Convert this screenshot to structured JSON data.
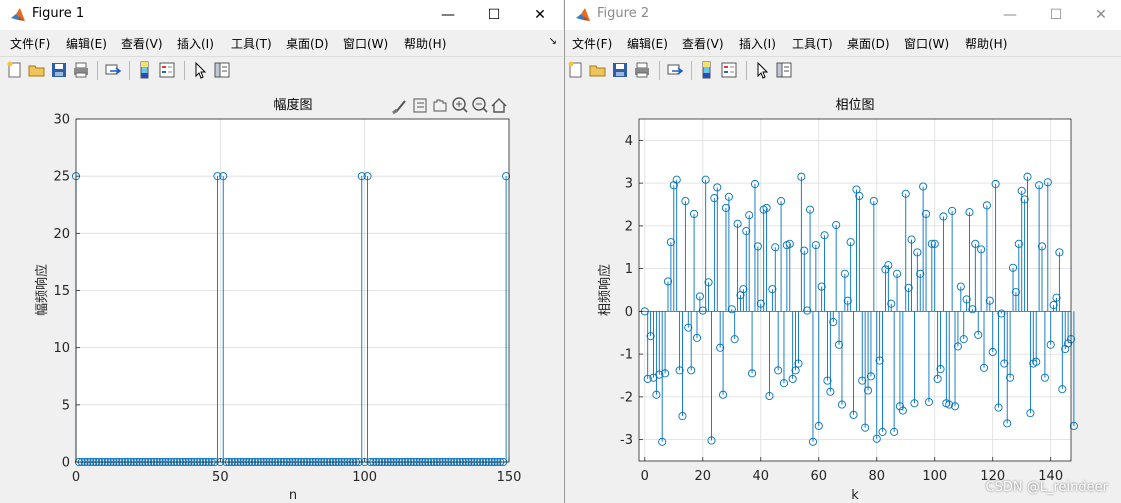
{
  "window1": {
    "title": "Figure 1",
    "min_glyph": "—",
    "max_glyph": "☐",
    "close_glyph": "✕",
    "menu": [
      "文件(F)",
      "编辑(E)",
      "查看(V)",
      "插入(I)",
      "工具(T)",
      "桌面(D)",
      "窗口(W)",
      "帮助(H)"
    ],
    "menu_more_glyph": "↘"
  },
  "window2": {
    "title": "Figure 2",
    "min_glyph": "—",
    "max_glyph": "☐",
    "close_glyph": "✕",
    "menu": [
      "文件(F)",
      "编辑(E)",
      "查看(V)",
      "插入(I)",
      "工具(T)",
      "桌面(D)",
      "窗口(W)",
      "帮助(H)"
    ]
  },
  "toolbar_icons": [
    "new-figure-icon",
    "open-file-icon",
    "save-icon",
    "print-icon",
    "link-plot-icon",
    "insert-colorbar-icon",
    "insert-legend-icon",
    "edit-plot-icon",
    "property-inspector-icon"
  ],
  "axes_toolbar_icons": [
    "brush-icon",
    "data-tips-icon",
    "pan-icon",
    "zoom-in-icon",
    "zoom-out-icon",
    "home-icon"
  ],
  "colors": {
    "stem": "#0072bd",
    "grid": "#dcdcdc",
    "axes_bg": "#ffffff"
  },
  "watermark": "CSDN @L_reindeer",
  "chart_data": [
    {
      "type": "stem",
      "title": "幅度图",
      "xlabel": "n",
      "ylabel": "幅频响应",
      "xlim": [
        0,
        150
      ],
      "ylim": [
        0,
        30
      ],
      "xticks": [
        "0",
        "50",
        "100",
        "150"
      ],
      "yticks": [
        "0",
        "5",
        "10",
        "15",
        "20",
        "25",
        "30"
      ],
      "grid": true,
      "x": [
        0,
        1,
        2,
        3,
        4,
        5,
        6,
        7,
        8,
        9,
        10,
        11,
        12,
        13,
        14,
        15,
        16,
        17,
        18,
        19,
        20,
        21,
        22,
        23,
        24,
        25,
        26,
        27,
        28,
        29,
        30,
        31,
        32,
        33,
        34,
        35,
        36,
        37,
        38,
        39,
        40,
        41,
        42,
        43,
        44,
        45,
        46,
        47,
        48,
        49,
        50,
        51,
        52,
        53,
        54,
        55,
        56,
        57,
        58,
        59,
        60,
        61,
        62,
        63,
        64,
        65,
        66,
        67,
        68,
        69,
        70,
        71,
        72,
        73,
        74,
        75,
        76,
        77,
        78,
        79,
        80,
        81,
        82,
        83,
        84,
        85,
        86,
        87,
        88,
        89,
        90,
        91,
        92,
        93,
        94,
        95,
        96,
        97,
        98,
        99,
        100,
        101,
        102,
        103,
        104,
        105,
        106,
        107,
        108,
        109,
        110,
        111,
        112,
        113,
        114,
        115,
        116,
        117,
        118,
        119,
        120,
        121,
        122,
        123,
        124,
        125,
        126,
        127,
        128,
        129,
        130,
        131,
        132,
        133,
        134,
        135,
        136,
        137,
        138,
        139,
        140,
        141,
        142,
        143,
        144,
        145,
        146,
        147,
        148,
        149
      ],
      "values": [
        25,
        0,
        0,
        0,
        0,
        0,
        0,
        0,
        0,
        0,
        0,
        0,
        0,
        0,
        0,
        0,
        0,
        0,
        0,
        0,
        0,
        0,
        0,
        0,
        0,
        0,
        0,
        0,
        0,
        0,
        0,
        0,
        0,
        0,
        0,
        0,
        0,
        0,
        0,
        0,
        0,
        0,
        0,
        0,
        0,
        0,
        0,
        0,
        0,
        25,
        0,
        25,
        0,
        0,
        0,
        0,
        0,
        0,
        0,
        0,
        0,
        0,
        0,
        0,
        0,
        0,
        0,
        0,
        0,
        0,
        0,
        0,
        0,
        0,
        0,
        0,
        0,
        0,
        0,
        0,
        0,
        0,
        0,
        0,
        0,
        0,
        0,
        0,
        0,
        0,
        0,
        0,
        0,
        0,
        0,
        0,
        0,
        0,
        0,
        25,
        0,
        25,
        0,
        0,
        0,
        0,
        0,
        0,
        0,
        0,
        0,
        0,
        0,
        0,
        0,
        0,
        0,
        0,
        0,
        0,
        0,
        0,
        0,
        0,
        0,
        0,
        0,
        0,
        0,
        0,
        0,
        0,
        0,
        0,
        0,
        0,
        0,
        0,
        0,
        0,
        0,
        0,
        0,
        0,
        0,
        0,
        0,
        0,
        0,
        25
      ]
    },
    {
      "type": "stem",
      "title": "相位图",
      "xlabel": "k",
      "ylabel": "相频响应",
      "xlim": [
        -2,
        147
      ],
      "ylim": [
        -3.5,
        4.5
      ],
      "xticks": [
        "0",
        "20",
        "40",
        "60",
        "80",
        "100",
        "120",
        "140"
      ],
      "xtick_values": [
        0,
        20,
        40,
        60,
        80,
        100,
        120,
        140
      ],
      "yticks": [
        "-3",
        "-2",
        "-1",
        "0",
        "1",
        "2",
        "3",
        "4"
      ],
      "ytick_values": [
        -3,
        -2,
        -1,
        0,
        1,
        2,
        3,
        4
      ],
      "grid": true,
      "values": [
        0.0,
        -1.58,
        -0.58,
        -1.55,
        -1.95,
        -1.48,
        -3.05,
        -1.45,
        0.7,
        1.62,
        2.95,
        3.08,
        -1.38,
        -2.45,
        2.58,
        -0.38,
        -1.38,
        2.28,
        -0.62,
        0.35,
        0.02,
        3.08,
        0.68,
        -3.02,
        2.65,
        2.9,
        -0.85,
        -1.95,
        2.42,
        2.68,
        0.05,
        -0.65,
        2.05,
        0.38,
        0.52,
        1.88,
        2.25,
        -1.45,
        2.98,
        1.52,
        0.18,
        2.38,
        2.42,
        -1.98,
        0.52,
        1.5,
        -1.38,
        2.58,
        -1.68,
        1.55,
        1.58,
        -1.58,
        -1.38,
        -1.22,
        3.15,
        1.42,
        0.02,
        2.38,
        -3.05,
        1.55,
        -2.68,
        0.58,
        1.78,
        -1.62,
        -1.88,
        -0.25,
        2.02,
        -0.78,
        -2.18,
        0.88,
        0.25,
        1.62,
        -2.42,
        2.85,
        2.7,
        -1.62,
        -2.72,
        -1.85,
        -1.52,
        2.58,
        -2.98,
        -1.15,
        -2.82,
        0.98,
        1.08,
        0.18,
        -2.82,
        0.88,
        -2.22,
        -2.32,
        2.75,
        0.55,
        1.68,
        -2.15,
        1.38,
        0.88,
        2.92,
        2.28,
        -2.12,
        1.58,
        1.58,
        -1.58,
        -1.35,
        2.22,
        -2.15,
        -2.18,
        2.35,
        -2.22,
        -0.82,
        0.58,
        -0.65,
        0.28,
        2.32,
        0.05,
        1.58,
        -0.55,
        1.45,
        -1.32,
        2.48,
        0.25,
        -0.95,
        2.98,
        -2.25,
        -0.05,
        -1.22,
        -2.62,
        -1.55,
        1.02,
        0.45,
        1.58,
        2.82,
        2.62,
        3.15,
        -2.38,
        -1.22,
        -1.18,
        2.95,
        1.52,
        -1.55,
        3.02,
        -0.78,
        0.15,
        0.32,
        1.38,
        -1.82,
        -0.88,
        -0.75,
        -0.65,
        -2.68
      ]
    }
  ]
}
